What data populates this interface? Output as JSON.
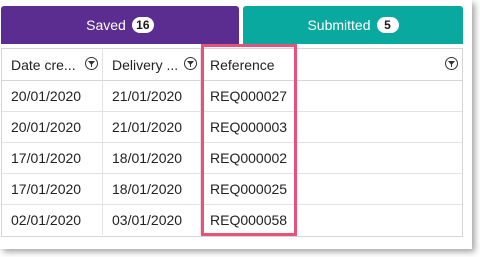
{
  "tabs": {
    "saved": {
      "label": "Saved",
      "count": "16"
    },
    "submitted": {
      "label": "Submitted",
      "count": "5"
    }
  },
  "columns": [
    {
      "label": "Date cre..."
    },
    {
      "label": "Delivery ..."
    },
    {
      "label": "Reference"
    }
  ],
  "rows": [
    {
      "date_created": "20/01/2020",
      "delivery": "21/01/2020",
      "reference": "REQ000027"
    },
    {
      "date_created": "20/01/2020",
      "delivery": "21/01/2020",
      "reference": "REQ000003"
    },
    {
      "date_created": "17/01/2020",
      "delivery": "18/01/2020",
      "reference": "REQ000002"
    },
    {
      "date_created": "17/01/2020",
      "delivery": "18/01/2020",
      "reference": "REQ000025"
    },
    {
      "date_created": "02/01/2020",
      "delivery": "03/01/2020",
      "reference": "REQ000058"
    }
  ],
  "colors": {
    "saved_tab": "#5b2d91",
    "submitted_tab": "#0aa9a0",
    "highlight": "#e8527a"
  },
  "icons": {
    "column_filter": "filter-icon"
  }
}
